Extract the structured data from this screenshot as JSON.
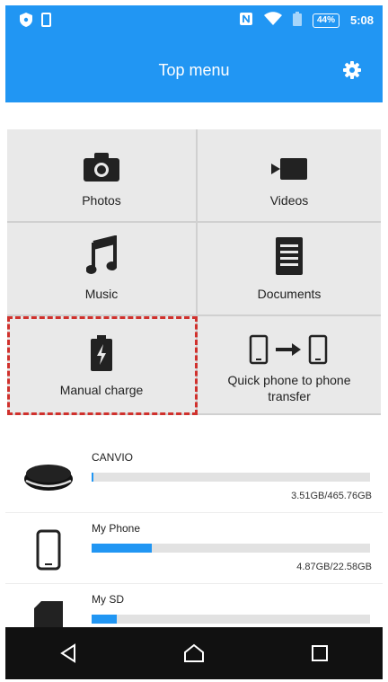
{
  "status_bar": {
    "battery_percent": "44%",
    "time": "5:08",
    "icons": [
      "shield-icon",
      "sim-icon",
      "nfc-icon",
      "wifi-icon",
      "battery-icon"
    ]
  },
  "header": {
    "title": "Top menu",
    "settings_icon": "gear-icon"
  },
  "menu": {
    "photos": "Photos",
    "videos": "Videos",
    "music": "Music",
    "documents": "Documents",
    "manual_charge": "Manual charge",
    "transfer_line1": "Quick phone to phone",
    "transfer_line2": "transfer"
  },
  "storage": [
    {
      "name": "CANVIO",
      "usage": "3.51GB/465.76GB",
      "fill_percent": 0.75
    },
    {
      "name": "My Phone",
      "usage": "4.87GB/22.58GB",
      "fill_percent": 21.6
    },
    {
      "name": "My SD",
      "usage": "",
      "fill_percent": 9
    }
  ],
  "colors": {
    "accent": "#2196f3",
    "highlight": "#d0312d"
  },
  "nav": {
    "icons": [
      "back-icon",
      "home-icon",
      "recents-icon"
    ]
  }
}
